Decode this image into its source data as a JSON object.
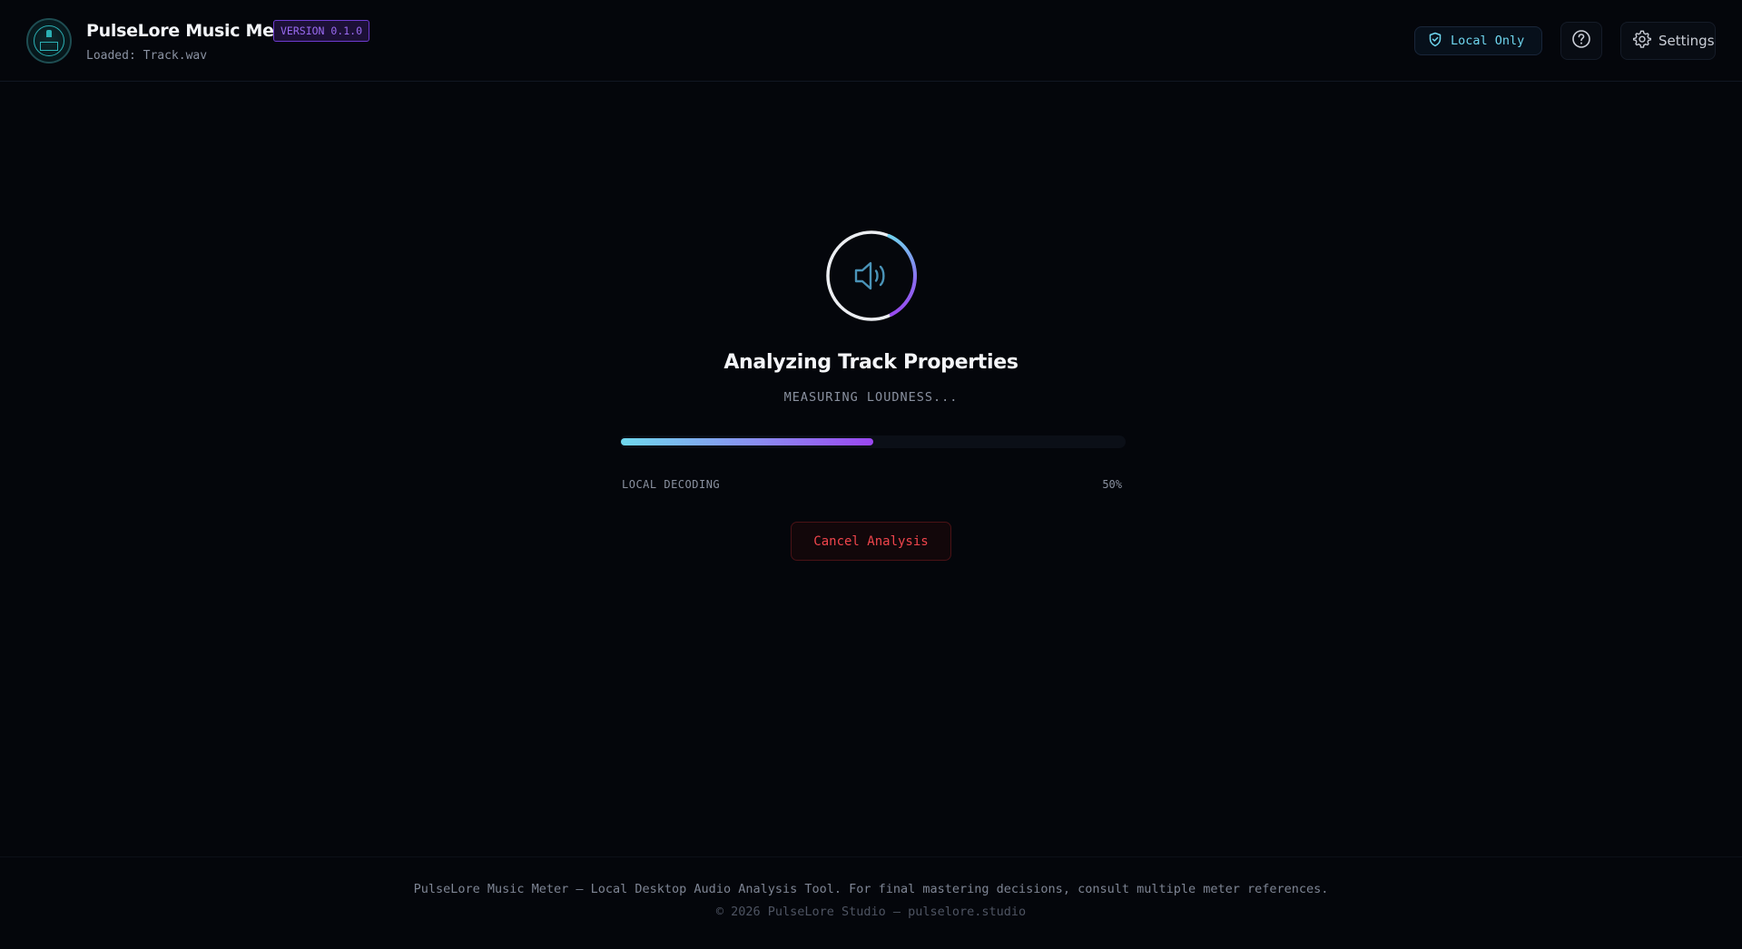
{
  "header": {
    "app_title": "PulseLore Music Meter",
    "version": "VERSION 0.1.0",
    "loaded_file": "Loaded: Track.wav",
    "local_only_label": "Local Only",
    "settings_label": "Settings"
  },
  "analysis": {
    "title": "Analyzing Track Properties",
    "status": "MEASURING LOUDNESS...",
    "progress_fraction": 0.5,
    "progress_stage": "LOCAL DECODING",
    "progress_percent": "50%",
    "cancel_label": "Cancel Analysis"
  },
  "footer": {
    "line1": "PulseLore Music Meter — Local Desktop Audio Analysis Tool. For final mastering decisions, consult multiple meter references.",
    "line2": "© 2026 PulseLore Studio — pulselore.studio"
  },
  "colors": {
    "background": "#04060b",
    "accent_cyan": "#6fd8ee",
    "accent_purple": "#9a46f0",
    "danger": "#f0454c"
  },
  "icons": {
    "logo": "pulselore-logo",
    "local_only": "shield-check-icon",
    "help": "help-circle-icon",
    "settings": "gear-icon",
    "analysis": "speaker-icon"
  }
}
